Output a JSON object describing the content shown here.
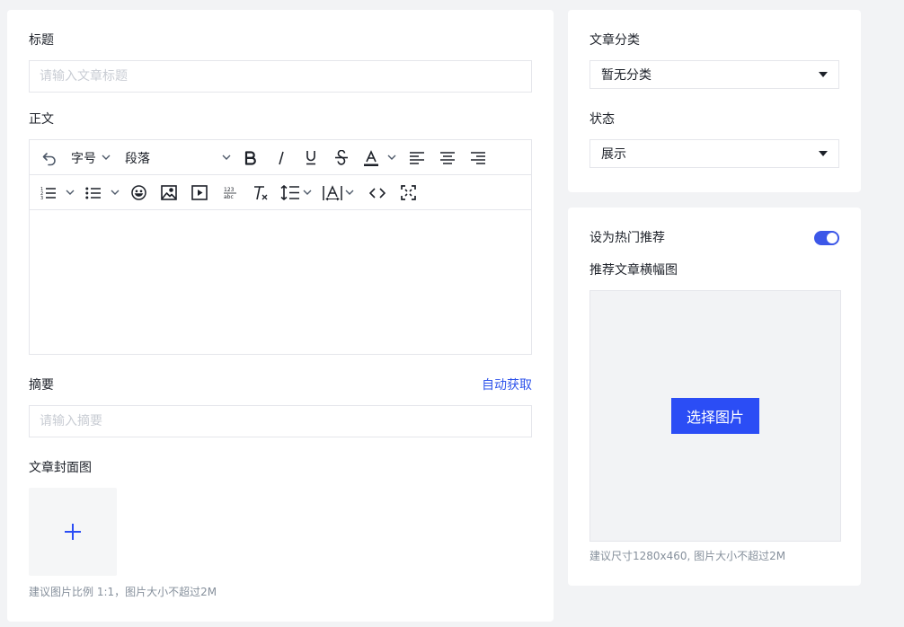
{
  "main": {
    "title_label": "标题",
    "title_placeholder": "请输入文章标题",
    "body_label": "正文",
    "editor": {
      "font_size_label": "字号",
      "paragraph_label": "段落"
    },
    "summary_label": "摘要",
    "summary_auto": "自动获取",
    "summary_placeholder": "请输入摘要",
    "cover_label": "文章封面图",
    "cover_hint": "建议图片比例 1:1，图片大小不超过2M"
  },
  "side": {
    "category_label": "文章分类",
    "category_value": "暂无分类",
    "status_label": "状态",
    "status_value": "展示",
    "hot_label": "设为热门推荐",
    "hot_enabled": true,
    "banner_label": "推荐文章横幅图",
    "banner_button": "选择图片",
    "banner_hint": "建议尺寸1280x460, 图片大小不超过2M"
  },
  "colors": {
    "accent": "#2b4df5",
    "switch_on": "#3c57e8",
    "link": "#2f54eb"
  },
  "icons": {
    "editor_toolbar": [
      "undo-icon",
      "font-size-dropdown",
      "paragraph-dropdown",
      "bold-icon",
      "italic-icon",
      "underline-icon",
      "strikethrough-icon",
      "font-color-icon",
      "align-left-icon",
      "align-center-icon",
      "align-right-icon",
      "ordered-list-icon",
      "bullet-list-icon",
      "emoji-icon",
      "image-icon",
      "video-icon",
      "text-case-icon",
      "clear-format-icon",
      "line-height-icon",
      "letter-spacing-icon",
      "code-icon",
      "fullscreen-icon"
    ],
    "upload": "plus-icon"
  }
}
